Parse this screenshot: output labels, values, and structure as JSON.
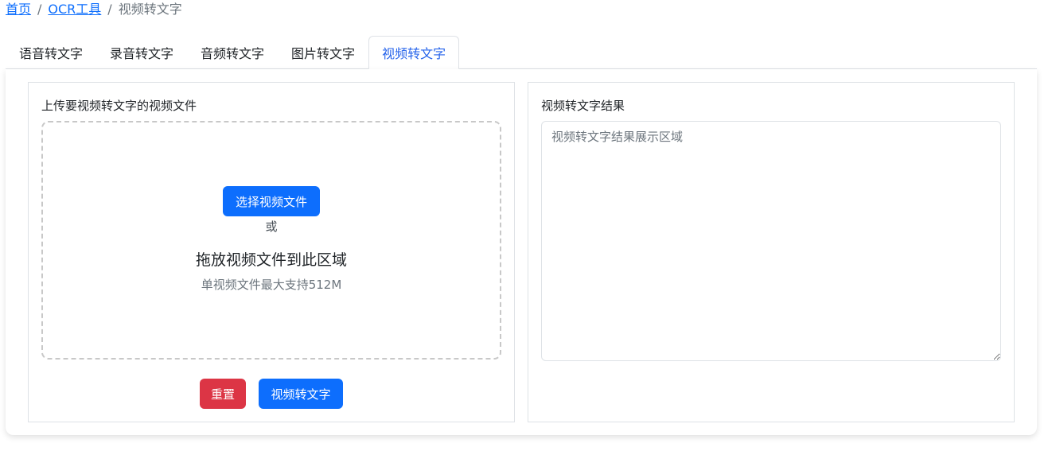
{
  "breadcrumb": {
    "home": "首页",
    "ocr": "OCR工具",
    "current": "视频转文字",
    "separator": "/"
  },
  "tabs": [
    {
      "label": "语音转文字",
      "active": false
    },
    {
      "label": "录音转文字",
      "active": false
    },
    {
      "label": "音频转文字",
      "active": false
    },
    {
      "label": "图片转文字",
      "active": false
    },
    {
      "label": "视频转文字",
      "active": true
    }
  ],
  "upload": {
    "label": "上传要视频转文字的视频文件",
    "choose_button": "选择视频文件",
    "or_text": "或",
    "drop_text": "拖放视频文件到此区域",
    "limit_text": "单视频文件最大支持512M",
    "reset_button": "重置",
    "convert_button": "视频转文字"
  },
  "result": {
    "label": "视频转文字结果",
    "placeholder": "视频转文字结果展示区域",
    "value": ""
  },
  "colors": {
    "primary": "#0d6efd",
    "danger": "#dc3545",
    "active_tab": "#2563eb"
  }
}
